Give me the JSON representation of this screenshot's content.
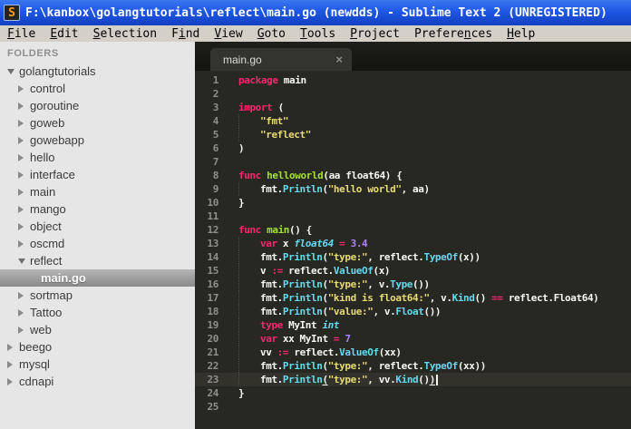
{
  "window": {
    "title": "F:\\kanbox\\golangtutorials\\reflect\\main.go (newdds) - Sublime Text 2 (UNREGISTERED)",
    "icon_letter": "S"
  },
  "menu_bar": {
    "items": [
      {
        "pre": "",
        "mn": "F",
        "post": "ile"
      },
      {
        "pre": "",
        "mn": "E",
        "post": "dit"
      },
      {
        "pre": "",
        "mn": "S",
        "post": "election"
      },
      {
        "pre": "F",
        "mn": "i",
        "post": "nd"
      },
      {
        "pre": "",
        "mn": "V",
        "post": "iew"
      },
      {
        "pre": "",
        "mn": "G",
        "post": "oto"
      },
      {
        "pre": "",
        "mn": "T",
        "post": "ools"
      },
      {
        "pre": "",
        "mn": "P",
        "post": "roject"
      },
      {
        "pre": "Prefere",
        "mn": "n",
        "post": "ces"
      },
      {
        "pre": "",
        "mn": "H",
        "post": "elp"
      }
    ]
  },
  "sidebar": {
    "header": "FOLDERS",
    "items": [
      {
        "label": "golangtutorials",
        "level": 0,
        "arrow": "expanded",
        "selected": false
      },
      {
        "label": "control",
        "level": 1,
        "arrow": "collapsed",
        "selected": false
      },
      {
        "label": "goroutine",
        "level": 1,
        "arrow": "collapsed",
        "selected": false
      },
      {
        "label": "goweb",
        "level": 1,
        "arrow": "collapsed",
        "selected": false
      },
      {
        "label": "gowebapp",
        "level": 1,
        "arrow": "collapsed",
        "selected": false
      },
      {
        "label": "hello",
        "level": 1,
        "arrow": "collapsed",
        "selected": false
      },
      {
        "label": "interface",
        "level": 1,
        "arrow": "collapsed",
        "selected": false
      },
      {
        "label": "main",
        "level": 1,
        "arrow": "collapsed",
        "selected": false
      },
      {
        "label": "mango",
        "level": 1,
        "arrow": "collapsed",
        "selected": false
      },
      {
        "label": "object",
        "level": 1,
        "arrow": "collapsed",
        "selected": false
      },
      {
        "label": "oscmd",
        "level": 1,
        "arrow": "collapsed",
        "selected": false
      },
      {
        "label": "reflect",
        "level": 1,
        "arrow": "expanded",
        "selected": false
      },
      {
        "label": "main.go",
        "level": 2,
        "arrow": "none",
        "selected": true
      },
      {
        "label": "sortmap",
        "level": 1,
        "arrow": "collapsed",
        "selected": false
      },
      {
        "label": "Tattoo",
        "level": 1,
        "arrow": "collapsed",
        "selected": false
      },
      {
        "label": "web",
        "level": 1,
        "arrow": "collapsed",
        "selected": false
      },
      {
        "label": "beego",
        "level": 0,
        "arrow": "collapsed",
        "selected": false
      },
      {
        "label": "mysql",
        "level": 0,
        "arrow": "collapsed",
        "selected": false
      },
      {
        "label": "cdnapi",
        "level": 0,
        "arrow": "collapsed",
        "selected": false
      }
    ]
  },
  "editor": {
    "tab": {
      "label": "main.go",
      "close_glyph": "×"
    },
    "caret_line": 23,
    "lines": [
      {
        "n": 1,
        "indent": 0,
        "tokens": [
          {
            "c": "kw",
            "s": "package"
          },
          {
            "c": "pl",
            "s": " main"
          }
        ]
      },
      {
        "n": 2,
        "indent": 0,
        "tokens": []
      },
      {
        "n": 3,
        "indent": 0,
        "tokens": [
          {
            "c": "kw",
            "s": "import"
          },
          {
            "c": "pl",
            "s": " ("
          }
        ]
      },
      {
        "n": 4,
        "indent": 1,
        "tokens": [
          {
            "c": "str",
            "s": "\"fmt\""
          }
        ]
      },
      {
        "n": 5,
        "indent": 1,
        "tokens": [
          {
            "c": "str",
            "s": "\"reflect\""
          }
        ]
      },
      {
        "n": 6,
        "indent": 0,
        "tokens": [
          {
            "c": "pl",
            "s": ")"
          }
        ]
      },
      {
        "n": 7,
        "indent": 0,
        "tokens": []
      },
      {
        "n": 8,
        "indent": 0,
        "tokens": [
          {
            "c": "kw",
            "s": "func"
          },
          {
            "c": "pl",
            "s": " "
          },
          {
            "c": "fn",
            "s": "helloworld"
          },
          {
            "c": "pl",
            "s": "(aa float64) {"
          }
        ]
      },
      {
        "n": 9,
        "indent": 1,
        "tokens": [
          {
            "c": "pl",
            "s": "fmt."
          },
          {
            "c": "call",
            "s": "Println"
          },
          {
            "c": "pl",
            "s": "("
          },
          {
            "c": "str",
            "s": "\"hello world\""
          },
          {
            "c": "pl",
            "s": ", aa)"
          }
        ]
      },
      {
        "n": 10,
        "indent": 0,
        "tokens": [
          {
            "c": "pl",
            "s": "}"
          }
        ]
      },
      {
        "n": 11,
        "indent": 0,
        "tokens": []
      },
      {
        "n": 12,
        "indent": 0,
        "tokens": [
          {
            "c": "kw",
            "s": "func"
          },
          {
            "c": "pl",
            "s": " "
          },
          {
            "c": "fn",
            "s": "main"
          },
          {
            "c": "pl",
            "s": "() {"
          }
        ]
      },
      {
        "n": 13,
        "indent": 1,
        "tokens": [
          {
            "c": "kw",
            "s": "var"
          },
          {
            "c": "pl",
            "s": " x "
          },
          {
            "c": "type",
            "s": "float64"
          },
          {
            "c": "pl",
            "s": " "
          },
          {
            "c": "kw",
            "s": "="
          },
          {
            "c": "pl",
            "s": " "
          },
          {
            "c": "num",
            "s": "3.4"
          }
        ]
      },
      {
        "n": 14,
        "indent": 1,
        "tokens": [
          {
            "c": "pl",
            "s": "fmt."
          },
          {
            "c": "call",
            "s": "Println"
          },
          {
            "c": "pl",
            "s": "("
          },
          {
            "c": "str",
            "s": "\"type:\""
          },
          {
            "c": "pl",
            "s": ", reflect."
          },
          {
            "c": "call",
            "s": "TypeOf"
          },
          {
            "c": "pl",
            "s": "(x))"
          }
        ]
      },
      {
        "n": 15,
        "indent": 1,
        "tokens": [
          {
            "c": "pl",
            "s": "v "
          },
          {
            "c": "kw",
            "s": ":="
          },
          {
            "c": "pl",
            "s": " reflect."
          },
          {
            "c": "call",
            "s": "ValueOf"
          },
          {
            "c": "pl",
            "s": "(x)"
          }
        ]
      },
      {
        "n": 16,
        "indent": 1,
        "tokens": [
          {
            "c": "pl",
            "s": "fmt."
          },
          {
            "c": "call",
            "s": "Println"
          },
          {
            "c": "pl",
            "s": "("
          },
          {
            "c": "str",
            "s": "\"type:\""
          },
          {
            "c": "pl",
            "s": ", v."
          },
          {
            "c": "call",
            "s": "Type"
          },
          {
            "c": "pl",
            "s": "())"
          }
        ]
      },
      {
        "n": 17,
        "indent": 1,
        "tokens": [
          {
            "c": "pl",
            "s": "fmt."
          },
          {
            "c": "call",
            "s": "Println"
          },
          {
            "c": "pl",
            "s": "("
          },
          {
            "c": "str",
            "s": "\"kind is float64:\""
          },
          {
            "c": "pl",
            "s": ", v."
          },
          {
            "c": "call",
            "s": "Kind"
          },
          {
            "c": "pl",
            "s": "() "
          },
          {
            "c": "kw",
            "s": "=="
          },
          {
            "c": "pl",
            "s": " reflect.Float64)"
          }
        ]
      },
      {
        "n": 18,
        "indent": 1,
        "tokens": [
          {
            "c": "pl",
            "s": "fmt."
          },
          {
            "c": "call",
            "s": "Println"
          },
          {
            "c": "pl",
            "s": "("
          },
          {
            "c": "str",
            "s": "\"value:\""
          },
          {
            "c": "pl",
            "s": ", v."
          },
          {
            "c": "call",
            "s": "Float"
          },
          {
            "c": "pl",
            "s": "())"
          }
        ]
      },
      {
        "n": 19,
        "indent": 1,
        "tokens": [
          {
            "c": "kw",
            "s": "type"
          },
          {
            "c": "pl",
            "s": " MyInt "
          },
          {
            "c": "type",
            "s": "int"
          }
        ]
      },
      {
        "n": 20,
        "indent": 1,
        "tokens": [
          {
            "c": "kw",
            "s": "var"
          },
          {
            "c": "pl",
            "s": " xx MyInt "
          },
          {
            "c": "kw",
            "s": "="
          },
          {
            "c": "pl",
            "s": " "
          },
          {
            "c": "num",
            "s": "7"
          }
        ]
      },
      {
        "n": 21,
        "indent": 1,
        "tokens": [
          {
            "c": "pl",
            "s": "vv "
          },
          {
            "c": "kw",
            "s": ":="
          },
          {
            "c": "pl",
            "s": " reflect."
          },
          {
            "c": "call",
            "s": "ValueOf"
          },
          {
            "c": "pl",
            "s": "(xx)"
          }
        ]
      },
      {
        "n": 22,
        "indent": 1,
        "tokens": [
          {
            "c": "pl",
            "s": "fmt."
          },
          {
            "c": "call",
            "s": "Println"
          },
          {
            "c": "pl",
            "s": "("
          },
          {
            "c": "str",
            "s": "\"type:\""
          },
          {
            "c": "pl",
            "s": ", reflect."
          },
          {
            "c": "call",
            "s": "TypeOf"
          },
          {
            "c": "pl",
            "s": "(xx))"
          }
        ]
      },
      {
        "n": 23,
        "indent": 1,
        "tokens": [
          {
            "c": "pl",
            "s": "fmt."
          },
          {
            "c": "call",
            "s": "Println"
          },
          {
            "c": "pl",
            "s": "(",
            "u": true
          },
          {
            "c": "str",
            "s": "\"type:\""
          },
          {
            "c": "pl",
            "s": ", vv."
          },
          {
            "c": "call",
            "s": "Kind"
          },
          {
            "c": "pl",
            "s": "()"
          },
          {
            "c": "pl",
            "s": ")",
            "u": true
          }
        ]
      },
      {
        "n": 24,
        "indent": 0,
        "tokens": [
          {
            "c": "pl",
            "s": "}"
          }
        ]
      },
      {
        "n": 25,
        "indent": 0,
        "tokens": []
      }
    ]
  },
  "colors": {
    "titlebar_blue": "#1e57e4",
    "menubar_gray": "#d4d0c8",
    "sidebar_bg": "#e7e6e6",
    "editor_bg": "#272822",
    "keyword": "#f92672",
    "function_name": "#a6e22e",
    "call": "#66d9ef",
    "type_italic": "#66d9ef",
    "string": "#e6db74",
    "number": "#ae81ff",
    "plain": "#f8f8f2",
    "line_number": "#8f908a"
  }
}
